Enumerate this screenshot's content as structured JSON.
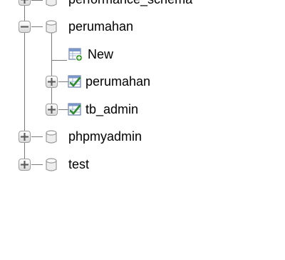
{
  "tree": {
    "databases": [
      {
        "label": "performance_schema",
        "state": "collapsed"
      },
      {
        "label": "perumahan",
        "state": "expanded",
        "children": {
          "new_label": "New",
          "tables": [
            {
              "label": "perumahan"
            },
            {
              "label": "tb_admin"
            }
          ]
        }
      },
      {
        "label": "phpmyadmin",
        "state": "collapsed"
      },
      {
        "label": "test",
        "state": "collapsed"
      }
    ]
  },
  "icons": {
    "expander_expanded": "minus-box-icon",
    "expander_collapsed": "plus-box-icon",
    "database": "database-cylinder-icon",
    "new": "new-table-icon",
    "table": "table-icon"
  },
  "colors": {
    "line": "#7a7a7a",
    "new_plus": "#3a9a2a",
    "table_check": "#2e8b2e"
  }
}
